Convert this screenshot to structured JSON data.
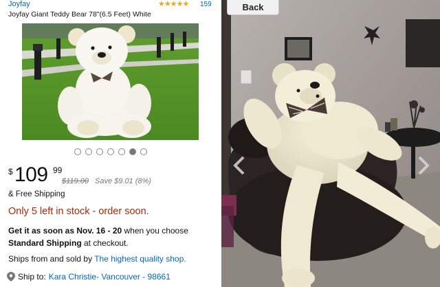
{
  "listing": {
    "brand": "Joyfay",
    "stars": "★★★★★",
    "review_count": "159",
    "title": "Joyfay Giant Teddy Bear 78\"(6.5 Feet) White",
    "price_currency": "$",
    "price_whole": "109",
    "price_fraction": "99",
    "old_price": "$119.00",
    "save_text": "Save $9.01 (8%)",
    "free_shipping": "& Free Shipping",
    "stock": "Only 5 left in stock - order soon.",
    "delivery_prefix": "Get it as soon as Nov. 16 - 20",
    "delivery_mid": " when you choose ",
    "delivery_method": "Standard Shipping",
    "delivery_suffix": " at checkout.",
    "ships_prefix": "Ships from and sold by ",
    "ships_seller": "The highest quality shop.",
    "shipto_label": "Ship to: ",
    "shipto_value": "Kara Christie- Vancouver - 98661",
    "image_dots": 7,
    "active_dot": 6
  },
  "viewer": {
    "back_label": "Back"
  },
  "colors": {
    "link": "#0066c0",
    "stock": "#b12704",
    "stars": "#f0a41c"
  },
  "icons": [
    "star-icon",
    "location-pin-icon",
    "chevron-left-icon",
    "chevron-right-icon"
  ]
}
